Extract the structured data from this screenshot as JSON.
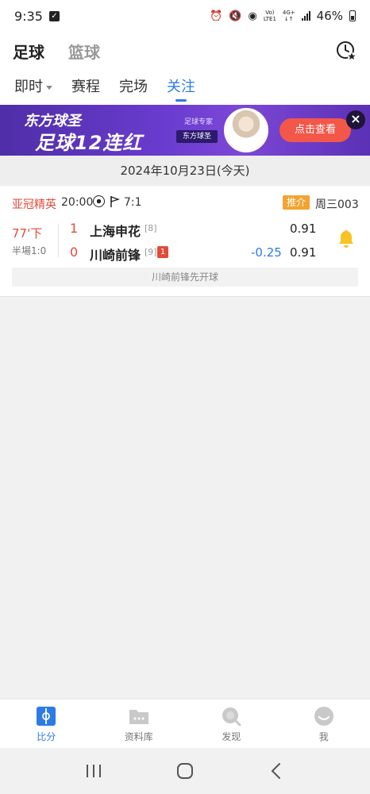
{
  "status_bar": {
    "time": "9:35",
    "network_top": "Vo)",
    "network_bottom": "LTE1",
    "gen_top": "4G+",
    "gen_bottom": "↓↑",
    "battery": "46%"
  },
  "header": {
    "sports": [
      {
        "label": "足球",
        "active": true
      },
      {
        "label": "篮球",
        "active": false
      }
    ]
  },
  "tabs": [
    {
      "label": "即时",
      "active": false,
      "dropdown": true
    },
    {
      "label": "赛程",
      "active": false
    },
    {
      "label": "完场",
      "active": false
    },
    {
      "label": "关注",
      "active": true
    }
  ],
  "banner": {
    "slogan_line1": "东方球圣",
    "slogan_line2": "足球12连红",
    "expert_tag": "足球专家",
    "expert_name": "东方球圣",
    "cta": "点击查看",
    "close": "×"
  },
  "date_bar": "2024年10月23日(今天)",
  "match": {
    "league": "亚冠精英",
    "kickoff": "20:00",
    "corners": "7:1",
    "recommend_badge": "推介",
    "match_no": "周三003",
    "minute": "77'下",
    "halftime": "半場1:0",
    "home": {
      "score": "1",
      "name": "上海申花",
      "rank": "[8]"
    },
    "away": {
      "score": "0",
      "name": "川崎前锋",
      "rank": "[9]",
      "red_cards": "1"
    },
    "odds_home": "0.91",
    "handicap": "-0.25",
    "odds_away": "0.91",
    "note": "川崎前锋先开球"
  },
  "bottom_nav": [
    {
      "label": "比分",
      "icon": "score-icon",
      "active": true
    },
    {
      "label": "资料库",
      "icon": "database-icon",
      "active": false
    },
    {
      "label": "发现",
      "icon": "discover-icon",
      "active": false
    },
    {
      "label": "我",
      "icon": "me-icon",
      "active": false
    }
  ],
  "colors": {
    "accent": "#2d7be5",
    "live_red": "#e24b3a",
    "badge_orange": "#f4a331",
    "bell_yellow": "#f7c325",
    "banner_purple": "#6a3ccf"
  }
}
